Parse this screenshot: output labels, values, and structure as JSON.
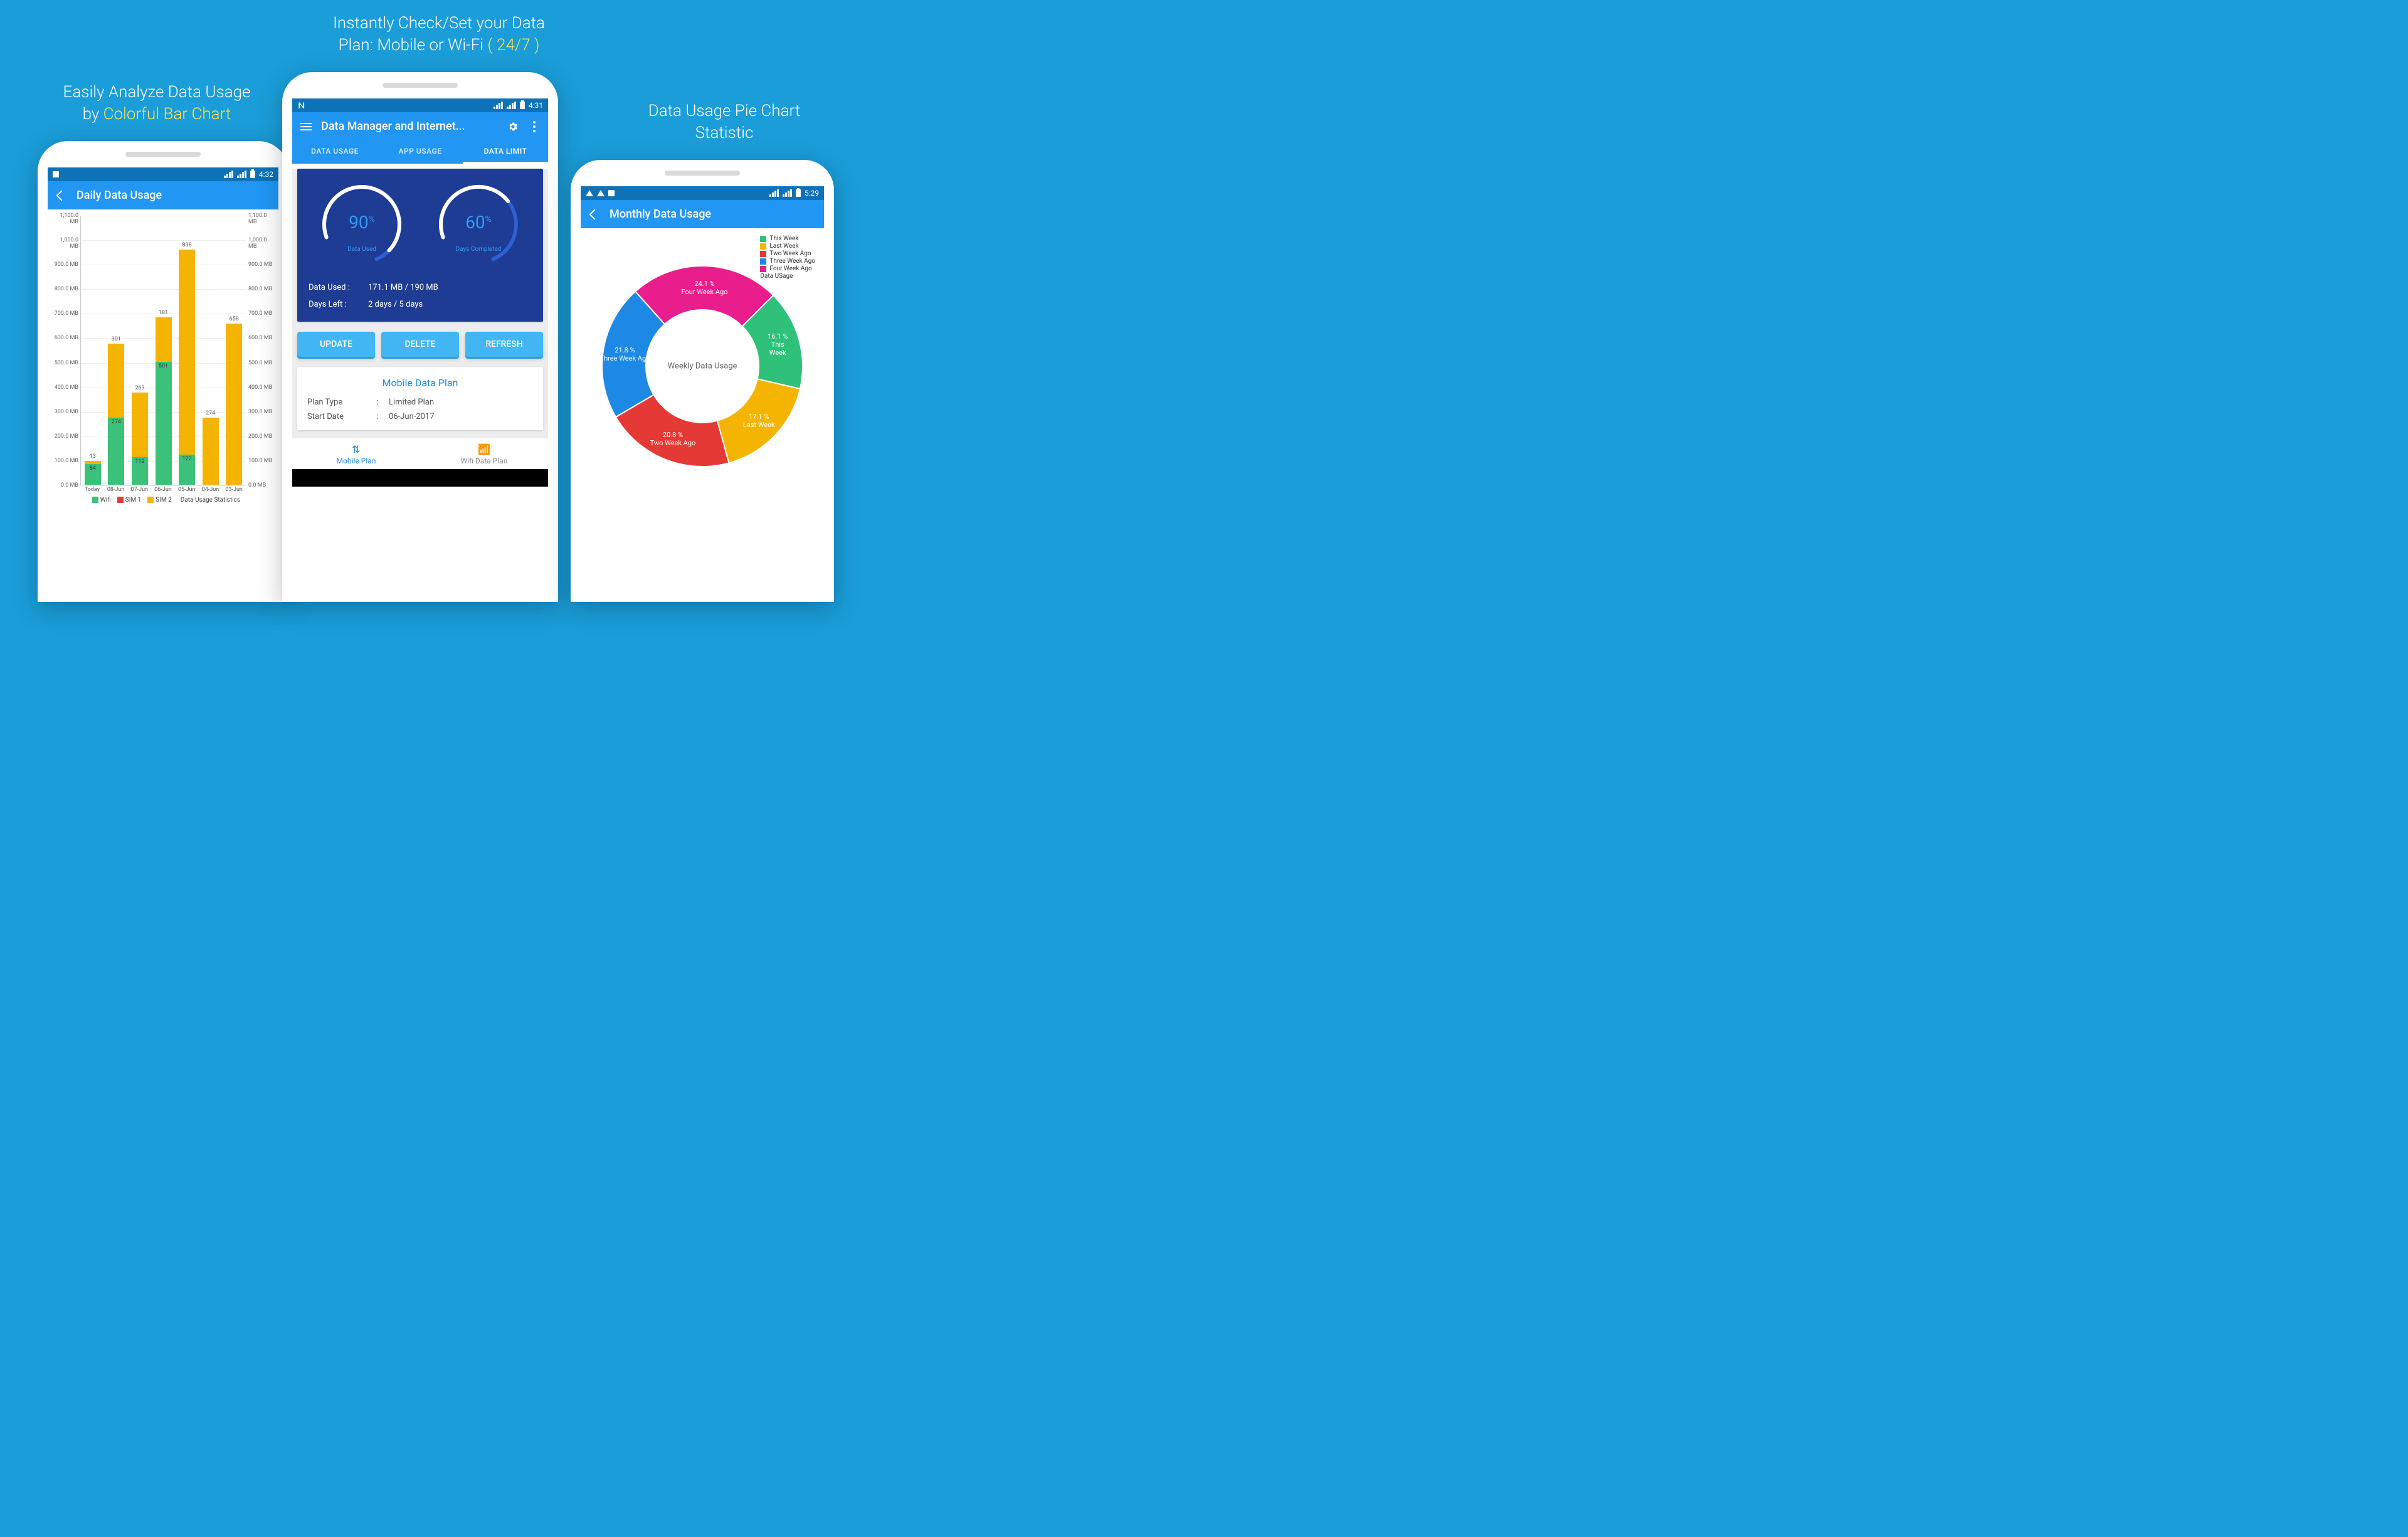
{
  "headlines": {
    "left_a": "Easily Analyze Data Usage",
    "left_b_pre": "by ",
    "left_b_accent": "Colorful Bar Chart",
    "center_a": "Instantly Check/Set your Data",
    "center_b_pre": "Plan: Mobile or Wi-Fi ",
    "center_b_accent": "( 24/7 )",
    "right_a": "Data Usage Pie Chart",
    "right_b": "Statistic"
  },
  "phone_left": {
    "status_time": "4:32",
    "appbar_title": "Daily Data Usage"
  },
  "phone_center": {
    "status_time": "4:31",
    "appbar_title": "Data Manager and Internet...",
    "tabs": {
      "t1": "DATA USAGE",
      "t2": "APP USAGE",
      "t3": "DATA LIMIT"
    },
    "gauge1": {
      "value": "90",
      "unit": "%",
      "label": "Data Used"
    },
    "gauge2": {
      "value": "60",
      "unit": "%",
      "label": "Days Completed"
    },
    "row_used_k": "Data Used  :",
    "row_used_v": "171.1 MB / 190 MB",
    "row_days_k": "Days Left  :",
    "row_days_v": "2 days / 5 days",
    "btn_update": "UPDATE",
    "btn_delete": "DELETE",
    "btn_refresh": "REFRESH",
    "plan_title": "Mobile Data Plan",
    "plan_type_k": "Plan Type",
    "plan_type_v": "Limited Plan",
    "plan_start_k": "Start Date",
    "plan_start_v": "06-Jun-2017",
    "bn_mobile": "Mobile Plan",
    "bn_wifi": "Wifi Data Plan"
  },
  "phone_right": {
    "status_time": "5:29",
    "appbar_title": "Monthly Data Usage",
    "legend": {
      "l1": "This Week",
      "l2": "Last Week",
      "l3": "Two Week Ago",
      "l4": "Three Week Ago",
      "l5": "Four Week Ago",
      "l6": "Data USage"
    },
    "center": "Weekly Data Usage"
  },
  "chart_data": [
    {
      "type": "bar",
      "title": "Daily Data Usage",
      "ylabel": "MB",
      "ylim": [
        0,
        1100
      ],
      "y_ticks": [
        "0.0 MB",
        "100.0 MB",
        "200.0 MB",
        "300.0 MB",
        "400.0 MB",
        "500.0 MB",
        "600.0 MB",
        "700.0 MB",
        "800.0 MB",
        "900.0 MB",
        "1,000.0 MB",
        "1,100.0 MB"
      ],
      "categories": [
        "Today",
        "08-Jun",
        "07-Jun",
        "06-Jun",
        "05-Jun",
        "04-Jun",
        "03-Jun"
      ],
      "series": [
        {
          "name": "Wifi",
          "color": "#3CC17A",
          "values": [
            84,
            274,
            112,
            501,
            122,
            0,
            0
          ]
        },
        {
          "name": "SIM 1",
          "color": "#E53935",
          "values": [
            0,
            0,
            0,
            0,
            0,
            0,
            0
          ]
        },
        {
          "name": "SIM 2",
          "color": "#F5B400",
          "values": [
            13,
            301,
            263,
            181,
            838,
            274,
            658
          ]
        }
      ],
      "top_labels": [
        [
          "13",
          "84"
        ],
        [
          "301",
          "274"
        ],
        [
          "263",
          "112"
        ],
        [
          "181",
          "501"
        ],
        [
          "838",
          "122"
        ],
        [
          "274"
        ],
        [
          "658"
        ]
      ],
      "legend_suffix": "Data Usage Statistics"
    },
    {
      "type": "pie",
      "title": "Weekly Data Usage",
      "series": [
        {
          "name": "This Week",
          "color": "#2FC17A",
          "value": 16.1
        },
        {
          "name": "Last Week",
          "color": "#F5B400",
          "value": 17.1
        },
        {
          "name": "Two Week Ago",
          "color": "#E53935",
          "value": 20.8
        },
        {
          "name": "Three Week Ago",
          "color": "#1E88E5",
          "value": 21.8
        },
        {
          "name": "Four Week Ago",
          "color": "#E91E8C",
          "value": 24.1
        }
      ]
    }
  ]
}
